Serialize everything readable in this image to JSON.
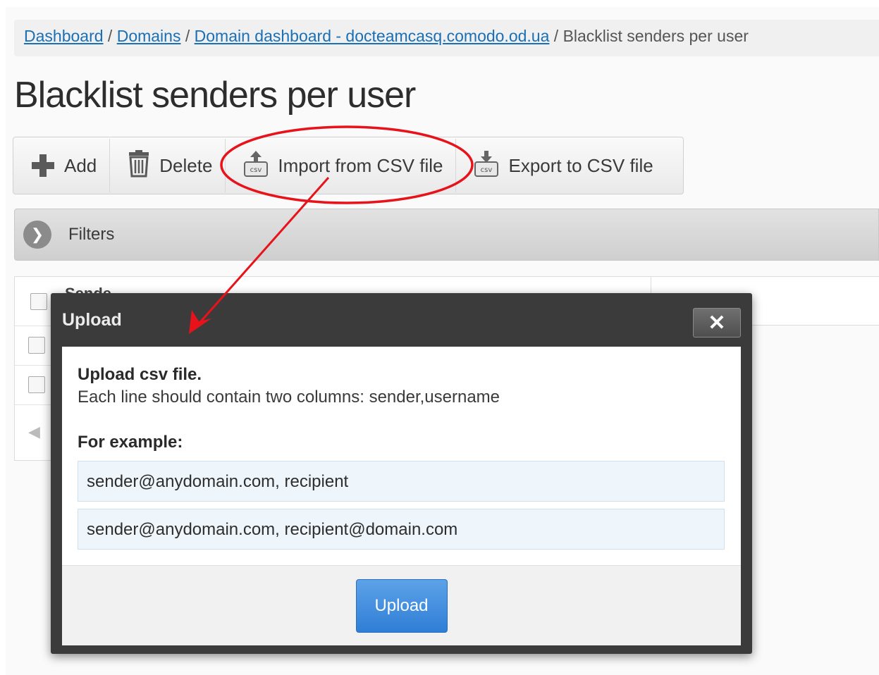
{
  "breadcrumb": {
    "items": [
      "Dashboard",
      "Domains",
      "Domain dashboard - docteamcasq.comodo.od.ua"
    ],
    "separator": "/",
    "current": "Blacklist senders per user"
  },
  "page_title": "Blacklist senders per user",
  "toolbar": {
    "add_label": "Add",
    "delete_label": "Delete",
    "import_label": "Import from CSV file",
    "export_label": "Export to CSV file"
  },
  "filters": {
    "label": "Filters"
  },
  "table": {
    "header_partial": "Sende"
  },
  "modal": {
    "title": "Upload",
    "close_glyph": "✕",
    "heading": "Upload csv file.",
    "description": "Each line should contain two columns: sender,username",
    "example_label": "For example:",
    "examples": [
      "sender@anydomain.com, recipient",
      "sender@anydomain.com, recipient@domain.com"
    ],
    "upload_label": "Upload"
  },
  "icons": {
    "add": "plus-icon",
    "delete": "trash-icon",
    "import": "csv-import-icon",
    "export": "csv-export-icon",
    "filters": "chevron-right-icon",
    "pager": "first-page-icon"
  },
  "colors": {
    "link": "#1a6fb5",
    "modal_header": "#3b3b3b",
    "upload_button": "#3f8ddd",
    "example_bg": "#eef5fb",
    "annotation": "#e8121a"
  }
}
